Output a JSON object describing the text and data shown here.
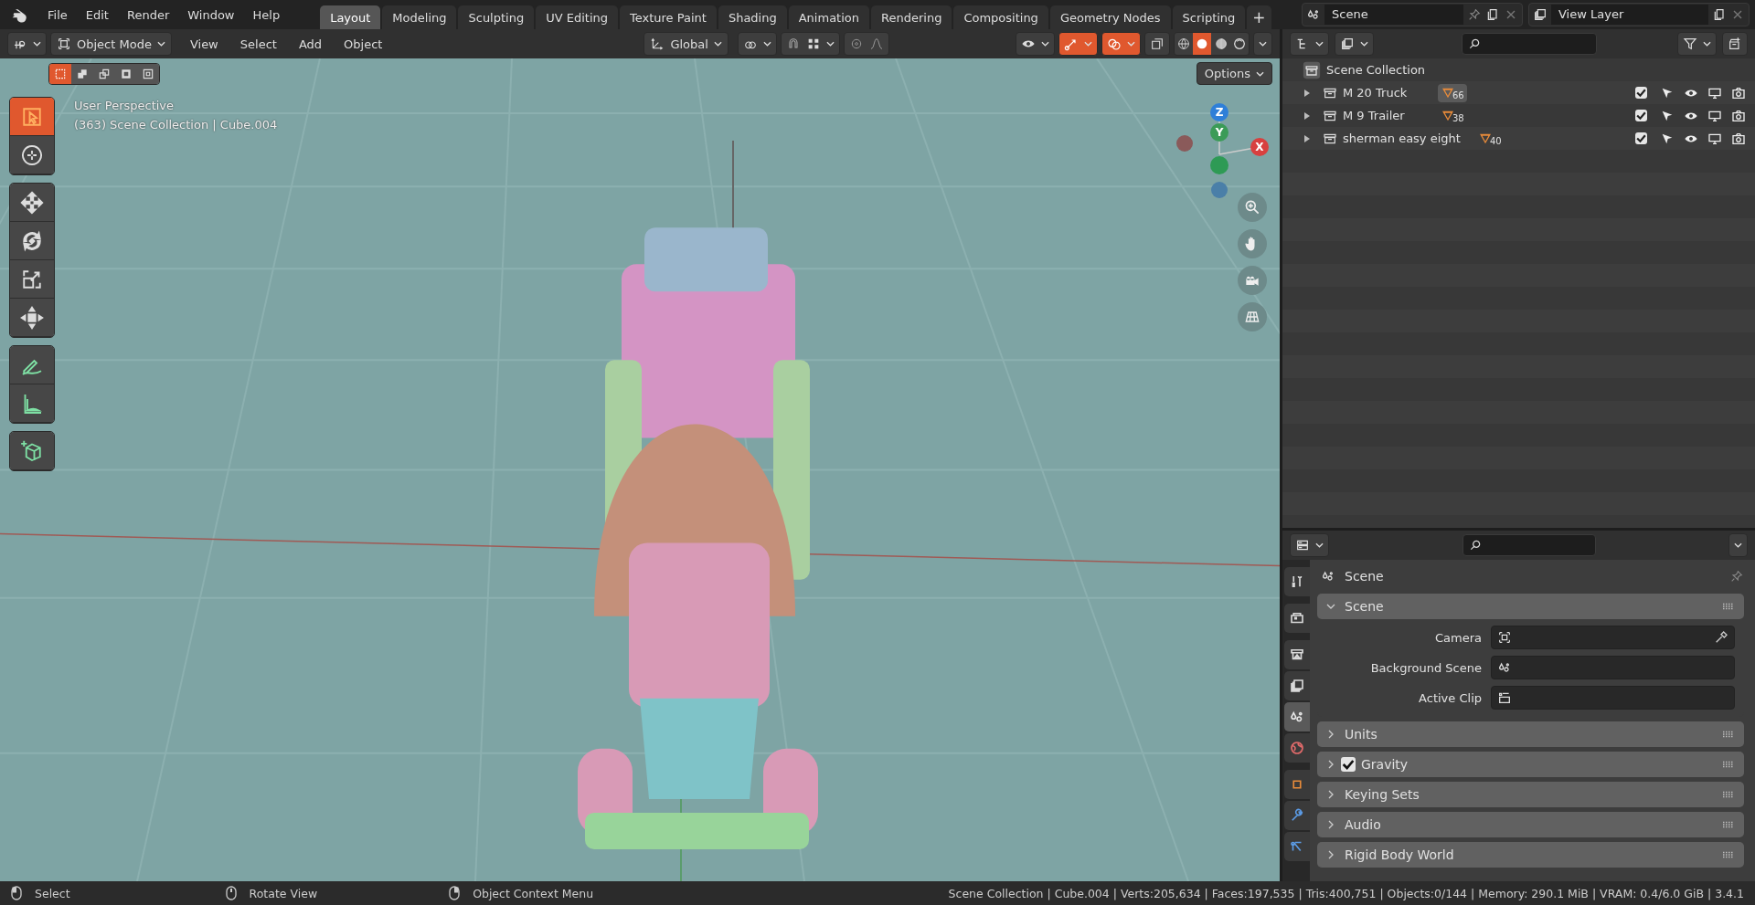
{
  "top_bar": {
    "menus": [
      "File",
      "Edit",
      "Render",
      "Window",
      "Help"
    ],
    "workspace_tabs": [
      {
        "label": "Layout",
        "selected": true
      },
      {
        "label": "Modeling",
        "selected": false
      },
      {
        "label": "Sculpting",
        "selected": false
      },
      {
        "label": "UV Editing",
        "selected": false
      },
      {
        "label": "Texture Paint",
        "selected": false
      },
      {
        "label": "Shading",
        "selected": false
      },
      {
        "label": "Animation",
        "selected": false
      },
      {
        "label": "Rendering",
        "selected": false
      },
      {
        "label": "Compositing",
        "selected": false
      },
      {
        "label": "Geometry Nodes",
        "selected": false
      },
      {
        "label": "Scripting",
        "selected": false
      }
    ],
    "add_tab": "+",
    "scene": "Scene",
    "view_layer": "View Layer"
  },
  "viewport_header": {
    "mode": "Object Mode",
    "menus": [
      "View",
      "Select",
      "Add",
      "Object"
    ],
    "orientation": "Global",
    "toggles": [
      {
        "kind": "gizmos",
        "on": true
      },
      {
        "kind": "overlays",
        "on": true
      },
      {
        "kind": "xray",
        "on": false
      }
    ],
    "shading_modes": [
      {
        "kind": "wireframe",
        "selected": false
      },
      {
        "kind": "solid",
        "selected": true
      },
      {
        "kind": "material",
        "selected": false
      },
      {
        "kind": "rendered",
        "selected": false
      }
    ]
  },
  "viewport": {
    "select_modes": [
      {
        "kind": "set",
        "selected": true
      },
      {
        "kind": "extend",
        "selected": false
      },
      {
        "kind": "subtract",
        "selected": false
      },
      {
        "kind": "invert",
        "selected": false
      },
      {
        "kind": "intersect",
        "selected": false
      }
    ],
    "options": "Options",
    "view_name": "User Perspective",
    "context": "(363) Scene Collection | Cube.004",
    "tool_groups": [
      [
        {
          "kind": "select_box",
          "selected": true
        },
        {
          "kind": "cursor",
          "selected": false
        }
      ],
      [
        {
          "kind": "move",
          "selected": false
        },
        {
          "kind": "rotate",
          "selected": false
        },
        {
          "kind": "scale",
          "selected": false
        },
        {
          "kind": "transform",
          "selected": false
        }
      ],
      [
        {
          "kind": "annotate",
          "selected": false
        },
        {
          "kind": "measure",
          "selected": false
        }
      ],
      [
        {
          "kind": "add_cube",
          "selected": false
        }
      ]
    ],
    "gizmo_axes": [
      {
        "label": "Z",
        "color": "#2f7fd8"
      },
      {
        "label": "Y",
        "color": "#3b9b57"
      },
      {
        "label": "X",
        "color": "#d8403f"
      }
    ]
  },
  "outliner": {
    "root": "Scene Collection",
    "items": [
      {
        "name": "M 20 Truck",
        "count": "66",
        "active": true,
        "checked": true
      },
      {
        "name": "M 9 Trailer",
        "count": "38",
        "active": false,
        "checked": true
      },
      {
        "name": "sherman easy eight",
        "count": "40",
        "active": false,
        "checked": true
      }
    ]
  },
  "properties": {
    "tabs": [
      {
        "kind": "tool",
        "selected": false
      },
      {
        "kind": "render",
        "selected": false
      },
      {
        "kind": "output",
        "selected": false
      },
      {
        "kind": "view_layer",
        "selected": false
      },
      {
        "kind": "scene",
        "selected": true
      },
      {
        "kind": "world",
        "selected": false
      },
      {
        "kind": "object",
        "selected": false
      },
      {
        "kind": "modifiers",
        "selected": false
      },
      {
        "kind": "particles",
        "selected": false
      }
    ],
    "context": "Scene",
    "panels": [
      {
        "title": "Scene",
        "expanded": true,
        "fields": [
          {
            "label": "Camera",
            "kind": "camera"
          },
          {
            "label": "Background Scene",
            "kind": "scene"
          },
          {
            "label": "Active Clip",
            "kind": "clip"
          }
        ]
      },
      {
        "title": "Units",
        "expanded": false
      },
      {
        "title": "Gravity",
        "expanded": false,
        "checked": true
      },
      {
        "title": "Keying Sets",
        "expanded": false
      },
      {
        "title": "Audio",
        "expanded": false
      },
      {
        "title": "Rigid Body World",
        "expanded": false
      }
    ]
  },
  "status_bar": {
    "hints": [
      {
        "kind": "left",
        "label": "Select"
      },
      {
        "kind": "middle",
        "label": "Rotate View"
      },
      {
        "kind": "right",
        "label": "Object Context Menu"
      }
    ],
    "stats": "Scene Collection | Cube.004 | Verts:205,634 | Faces:197,535 | Tris:400,751 | Objects:0/144 | Memory: 290.1 MiB | VRAM: 0.4/6.0 GiB | 3.4.1"
  }
}
